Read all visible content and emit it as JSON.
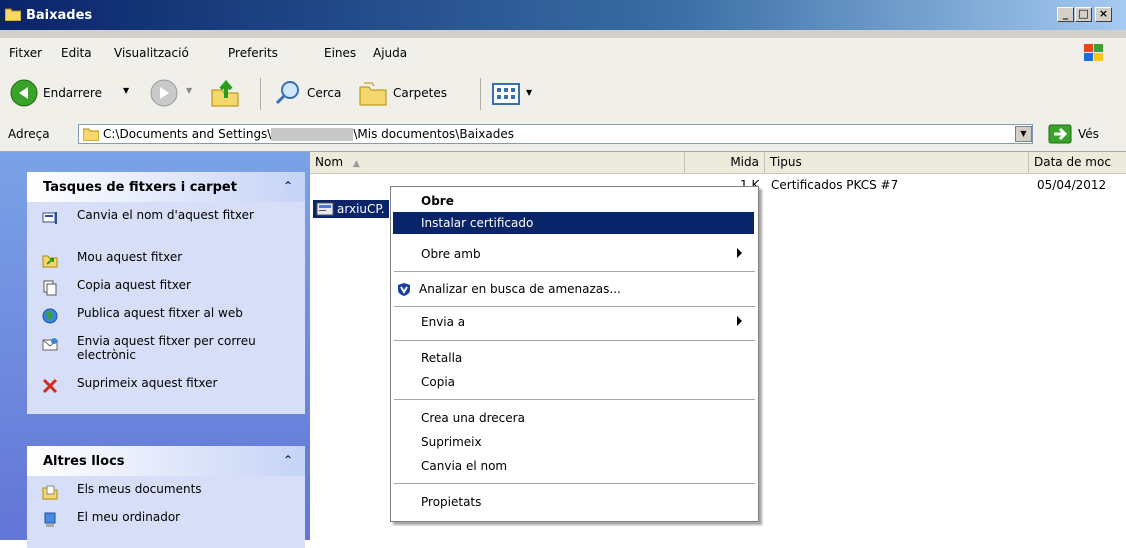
{
  "window": {
    "title": "Baixades"
  },
  "menubar": {
    "items": [
      "Fitxer",
      "Edita",
      "Visualització",
      "Preferits",
      "Eines",
      "Ajuda"
    ]
  },
  "toolbar": {
    "back_label": "Endarrere",
    "search_label": "Cerca",
    "folders_label": "Carpetes"
  },
  "address": {
    "label": "Adreça",
    "path_prefix": "C:\\Documents and Settings\\",
    "path_suffix": "\\Mis documentos\\Baixades",
    "go_label": "Vés"
  },
  "file_tasks": {
    "title": "Tasques de fitxers i carpet",
    "items": [
      "Canvia el nom d'aquest fitxer",
      "Mou aquest fitxer",
      "Copia aquest fitxer",
      "Publica aquest fitxer al web",
      "Envia aquest fitxer per correu electrònic",
      "Suprimeix aquest fitxer"
    ]
  },
  "other_places": {
    "title": "Altres llocs",
    "items": [
      "Els meus documents",
      "El meu ordinador"
    ]
  },
  "filelist": {
    "columns": {
      "name": "Nom",
      "size": "Mida",
      "type": "Tipus",
      "date": "Data de moc"
    },
    "row": {
      "name": "arxiuCP.",
      "size_partial": "1 K",
      "type": "Certificados PKCS #7",
      "date": "05/04/2012"
    }
  },
  "context_menu": {
    "open": "Obre",
    "install": "Instalar certificado",
    "open_with": "Obre amb",
    "scan": "Analizar en busca de amenazas...",
    "send_to": "Envia a",
    "cut": "Retalla",
    "copy": "Copia",
    "shortcut": "Crea una drecera",
    "delete": "Suprimeix",
    "rename": "Canvia el nom",
    "properties": "Propietats"
  },
  "colors": {
    "selection": "#0a246a",
    "taskpane": "#6375d6"
  }
}
